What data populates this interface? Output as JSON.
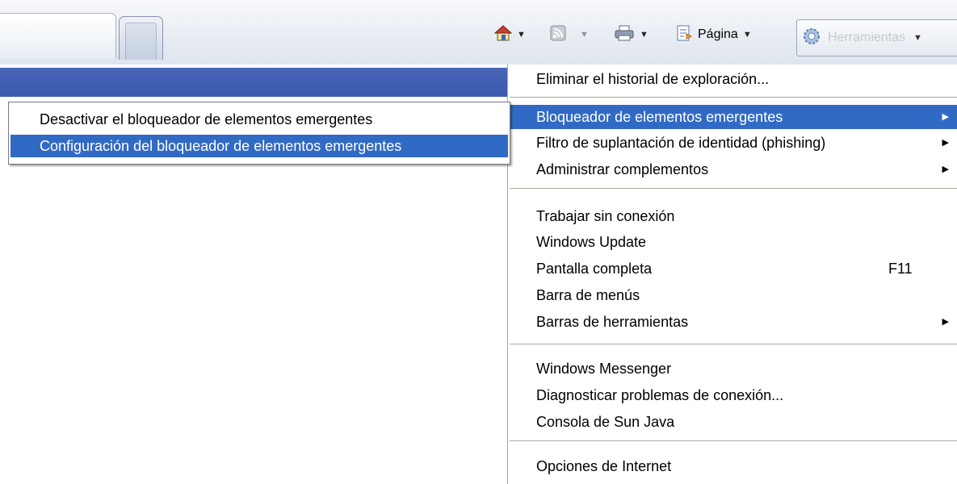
{
  "toolbar": {
    "home_icon": "home-icon",
    "feeds_icon": "feeds-icon",
    "print_icon": "print-icon",
    "page_icon": "page-icon",
    "page_label": "Página",
    "tools_icon": "gear-icon",
    "tools_label": "Herramientas"
  },
  "tools_menu": {
    "items": [
      {
        "label": "Eliminar el historial de exploración..."
      },
      {
        "label": "Bloqueador de elementos emergentes"
      },
      {
        "label": "Filtro de suplantación de identidad (phishing)"
      },
      {
        "label": "Administrar complementos"
      },
      {
        "label": "Trabajar sin conexión"
      },
      {
        "label": "Windows Update"
      },
      {
        "label": "Pantalla completa",
        "shortcut": "F11"
      },
      {
        "label": "Barra de menús"
      },
      {
        "label": "Barras de herramientas"
      },
      {
        "label": "Windows Messenger"
      },
      {
        "label": "Diagnosticar problemas de conexión..."
      },
      {
        "label": "Consola de Sun Java"
      },
      {
        "label": "Opciones de Internet"
      }
    ]
  },
  "popup_submenu": {
    "items": [
      {
        "label": "Desactivar el bloqueador de elementos emergentes"
      },
      {
        "label": "Configuración del bloqueador de elementos emergentes"
      }
    ]
  },
  "colors": {
    "highlight": "#316ac5",
    "band": "#3a58ad",
    "separator": "#aca899"
  }
}
